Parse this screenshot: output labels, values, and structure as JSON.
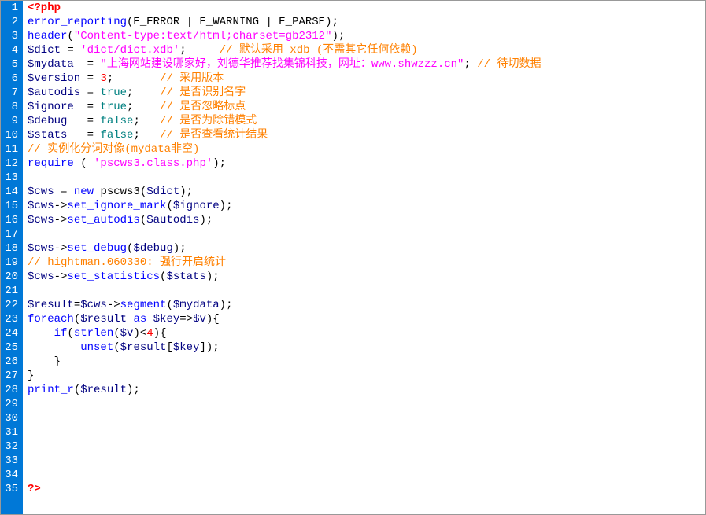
{
  "editor": {
    "language": "php",
    "line_count": 35,
    "lines": [
      {
        "n": 1,
        "tokens": [
          {
            "c": "t-tag",
            "t": "<?php"
          }
        ]
      },
      {
        "n": 2,
        "tokens": [
          {
            "c": "t-kw",
            "t": "error_reporting"
          },
          {
            "c": "t-def",
            "t": "(E_ERROR | E_WARNING | E_PARSE);"
          }
        ]
      },
      {
        "n": 3,
        "tokens": [
          {
            "c": "t-kw",
            "t": "header"
          },
          {
            "c": "t-def",
            "t": "("
          },
          {
            "c": "t-str",
            "t": "\"Content-type:text/html;charset=gb2312\""
          },
          {
            "c": "t-def",
            "t": ");"
          }
        ]
      },
      {
        "n": 4,
        "tokens": [
          {
            "c": "t-var",
            "t": "$dict"
          },
          {
            "c": "t-def",
            "t": " = "
          },
          {
            "c": "t-str",
            "t": "'dict/dict.xdb'"
          },
          {
            "c": "t-def",
            "t": ";     "
          },
          {
            "c": "t-com",
            "t": "// 默认采用 xdb (不需其它任何依赖)"
          }
        ]
      },
      {
        "n": 5,
        "tokens": [
          {
            "c": "t-var",
            "t": "$mydata"
          },
          {
            "c": "t-def",
            "t": "  = "
          },
          {
            "c": "t-str",
            "t": "\"上海网站建设哪家好，刘德华推荐找集锦科技，网址：www.shwzzz.cn\""
          },
          {
            "c": "t-def",
            "t": "; "
          },
          {
            "c": "t-com",
            "t": "// 待切数据"
          }
        ]
      },
      {
        "n": 6,
        "tokens": [
          {
            "c": "t-var",
            "t": "$version"
          },
          {
            "c": "t-def",
            "t": " = "
          },
          {
            "c": "t-num",
            "t": "3"
          },
          {
            "c": "t-def",
            "t": ";       "
          },
          {
            "c": "t-com",
            "t": "// 采用版本"
          }
        ]
      },
      {
        "n": 7,
        "tokens": [
          {
            "c": "t-var",
            "t": "$autodis"
          },
          {
            "c": "t-def",
            "t": " = "
          },
          {
            "c": "t-val",
            "t": "true"
          },
          {
            "c": "t-def",
            "t": ";    "
          },
          {
            "c": "t-com",
            "t": "// 是否识别名字"
          }
        ]
      },
      {
        "n": 8,
        "tokens": [
          {
            "c": "t-var",
            "t": "$ignore"
          },
          {
            "c": "t-def",
            "t": "  = "
          },
          {
            "c": "t-val",
            "t": "true"
          },
          {
            "c": "t-def",
            "t": ";    "
          },
          {
            "c": "t-com",
            "t": "// 是否忽略标点"
          }
        ]
      },
      {
        "n": 9,
        "tokens": [
          {
            "c": "t-var",
            "t": "$debug"
          },
          {
            "c": "t-def",
            "t": "   = "
          },
          {
            "c": "t-val",
            "t": "false"
          },
          {
            "c": "t-def",
            "t": ";   "
          },
          {
            "c": "t-com",
            "t": "// 是否为除错模式"
          }
        ]
      },
      {
        "n": 10,
        "tokens": [
          {
            "c": "t-var",
            "t": "$stats"
          },
          {
            "c": "t-def",
            "t": "   = "
          },
          {
            "c": "t-val",
            "t": "false"
          },
          {
            "c": "t-def",
            "t": ";   "
          },
          {
            "c": "t-com",
            "t": "// 是否查看统计结果"
          }
        ]
      },
      {
        "n": 11,
        "tokens": [
          {
            "c": "t-com",
            "t": "// 实例化分词对像(mydata非空)"
          }
        ]
      },
      {
        "n": 12,
        "tokens": [
          {
            "c": "t-kw",
            "t": "require"
          },
          {
            "c": "t-def",
            "t": " ( "
          },
          {
            "c": "t-str",
            "t": "'pscws3.class.php'"
          },
          {
            "c": "t-def",
            "t": ");"
          }
        ]
      },
      {
        "n": 13,
        "tokens": []
      },
      {
        "n": 14,
        "tokens": [
          {
            "c": "t-var",
            "t": "$cws"
          },
          {
            "c": "t-def",
            "t": " = "
          },
          {
            "c": "t-kw",
            "t": "new"
          },
          {
            "c": "t-def",
            "t": " pscws3("
          },
          {
            "c": "t-var",
            "t": "$dict"
          },
          {
            "c": "t-def",
            "t": ");"
          }
        ]
      },
      {
        "n": 15,
        "tokens": [
          {
            "c": "t-var",
            "t": "$cws"
          },
          {
            "c": "t-def",
            "t": "->"
          },
          {
            "c": "t-kw",
            "t": "set_ignore_mark"
          },
          {
            "c": "t-def",
            "t": "("
          },
          {
            "c": "t-var",
            "t": "$ignore"
          },
          {
            "c": "t-def",
            "t": ");"
          }
        ]
      },
      {
        "n": 16,
        "tokens": [
          {
            "c": "t-var",
            "t": "$cws"
          },
          {
            "c": "t-def",
            "t": "->"
          },
          {
            "c": "t-kw",
            "t": "set_autodis"
          },
          {
            "c": "t-def",
            "t": "("
          },
          {
            "c": "t-var",
            "t": "$autodis"
          },
          {
            "c": "t-def",
            "t": ");"
          }
        ]
      },
      {
        "n": 17,
        "tokens": []
      },
      {
        "n": 18,
        "tokens": [
          {
            "c": "t-var",
            "t": "$cws"
          },
          {
            "c": "t-def",
            "t": "->"
          },
          {
            "c": "t-kw",
            "t": "set_debug"
          },
          {
            "c": "t-def",
            "t": "("
          },
          {
            "c": "t-var",
            "t": "$debug"
          },
          {
            "c": "t-def",
            "t": ");"
          }
        ]
      },
      {
        "n": 19,
        "tokens": [
          {
            "c": "t-com",
            "t": "// hightman.060330: 强行开启统计"
          }
        ]
      },
      {
        "n": 20,
        "tokens": [
          {
            "c": "t-var",
            "t": "$cws"
          },
          {
            "c": "t-def",
            "t": "->"
          },
          {
            "c": "t-kw",
            "t": "set_statistics"
          },
          {
            "c": "t-def",
            "t": "("
          },
          {
            "c": "t-var",
            "t": "$stats"
          },
          {
            "c": "t-def",
            "t": ");"
          }
        ]
      },
      {
        "n": 21,
        "tokens": []
      },
      {
        "n": 22,
        "tokens": [
          {
            "c": "t-var",
            "t": "$result"
          },
          {
            "c": "t-def",
            "t": "="
          },
          {
            "c": "t-var",
            "t": "$cws"
          },
          {
            "c": "t-def",
            "t": "->"
          },
          {
            "c": "t-kw",
            "t": "segment"
          },
          {
            "c": "t-def",
            "t": "("
          },
          {
            "c": "t-var",
            "t": "$mydata"
          },
          {
            "c": "t-def",
            "t": ");"
          }
        ]
      },
      {
        "n": 23,
        "tokens": [
          {
            "c": "t-kw",
            "t": "foreach"
          },
          {
            "c": "t-def",
            "t": "("
          },
          {
            "c": "t-var",
            "t": "$result"
          },
          {
            "c": "t-def",
            "t": " "
          },
          {
            "c": "t-kw",
            "t": "as"
          },
          {
            "c": "t-def",
            "t": " "
          },
          {
            "c": "t-var",
            "t": "$key"
          },
          {
            "c": "t-def",
            "t": "=>"
          },
          {
            "c": "t-var",
            "t": "$v"
          },
          {
            "c": "t-def",
            "t": "){"
          }
        ]
      },
      {
        "n": 24,
        "tokens": [
          {
            "c": "t-def",
            "t": "    "
          },
          {
            "c": "t-kw",
            "t": "if"
          },
          {
            "c": "t-def",
            "t": "("
          },
          {
            "c": "t-kw",
            "t": "strlen"
          },
          {
            "c": "t-def",
            "t": "("
          },
          {
            "c": "t-var",
            "t": "$v"
          },
          {
            "c": "t-def",
            "t": ")<"
          },
          {
            "c": "t-num",
            "t": "4"
          },
          {
            "c": "t-def",
            "t": "){"
          }
        ]
      },
      {
        "n": 25,
        "tokens": [
          {
            "c": "t-def",
            "t": "        "
          },
          {
            "c": "t-kw",
            "t": "unset"
          },
          {
            "c": "t-def",
            "t": "("
          },
          {
            "c": "t-var",
            "t": "$result"
          },
          {
            "c": "t-def",
            "t": "["
          },
          {
            "c": "t-var",
            "t": "$key"
          },
          {
            "c": "t-def",
            "t": "]);"
          }
        ]
      },
      {
        "n": 26,
        "tokens": [
          {
            "c": "t-def",
            "t": "    }"
          }
        ]
      },
      {
        "n": 27,
        "tokens": [
          {
            "c": "t-def",
            "t": "}"
          }
        ]
      },
      {
        "n": 28,
        "tokens": [
          {
            "c": "t-kw",
            "t": "print_r"
          },
          {
            "c": "t-def",
            "t": "("
          },
          {
            "c": "t-var",
            "t": "$result"
          },
          {
            "c": "t-def",
            "t": ");"
          }
        ]
      },
      {
        "n": 29,
        "tokens": []
      },
      {
        "n": 30,
        "tokens": []
      },
      {
        "n": 31,
        "tokens": []
      },
      {
        "n": 32,
        "tokens": []
      },
      {
        "n": 33,
        "tokens": []
      },
      {
        "n": 34,
        "tokens": []
      },
      {
        "n": 35,
        "tokens": [
          {
            "c": "t-tag",
            "t": "?>"
          }
        ]
      }
    ]
  }
}
